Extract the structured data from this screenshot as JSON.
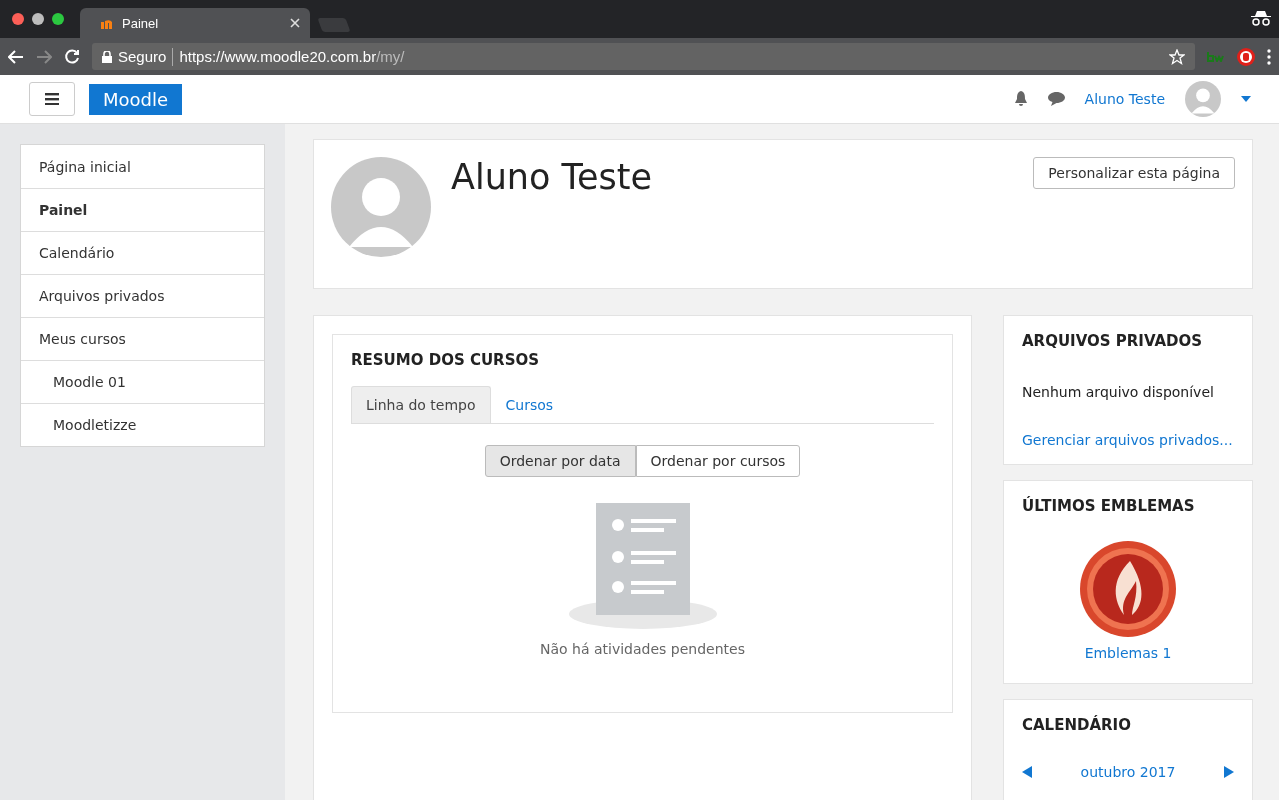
{
  "browser": {
    "tab_title": "Painel",
    "secure_label": "Seguro",
    "url_host": "https://www.moodle20.com.br",
    "url_path": "/my/"
  },
  "navbar": {
    "brand": "Moodle",
    "user_name": "Aluno Teste"
  },
  "nav_drawer": {
    "items": [
      {
        "label": "Página inicial",
        "selected": false
      },
      {
        "label": "Painel",
        "selected": true
      },
      {
        "label": "Calendário",
        "selected": false
      },
      {
        "label": "Arquivos privados",
        "selected": false
      },
      {
        "label": "Meus cursos",
        "selected": false,
        "children": [
          {
            "label": "Moodle 01",
            "selected": false
          },
          {
            "label": "Moodletizze",
            "selected": false
          }
        ]
      }
    ]
  },
  "page_header": {
    "name": "Aluno Teste",
    "button": "Personalizar esta página"
  },
  "course_overview": {
    "title": "RESUMO DOS CURSOS",
    "tabs": [
      {
        "label": "Linha do tempo",
        "selected": true
      },
      {
        "label": "Cursos",
        "selected": false
      }
    ],
    "sort_buttons": [
      {
        "label": "Ordenar por data",
        "selected": true
      },
      {
        "label": "Ordenar por cursos",
        "selected": false
      }
    ],
    "empty_text": "Não há atividades pendentes"
  },
  "blocks": [
    {
      "kind": "files",
      "title": "ARQUIVOS PRIVADOS",
      "text": "Nenhum arquivo disponível",
      "link": "Gerenciar arquivos privados..."
    },
    {
      "kind": "badges",
      "title": "ÚLTIMOS EMBLEMAS",
      "badge": "Emblemas 1"
    },
    {
      "kind": "calendar",
      "title": "CALENDÁRIO",
      "month": "outubro 2017"
    }
  ]
}
